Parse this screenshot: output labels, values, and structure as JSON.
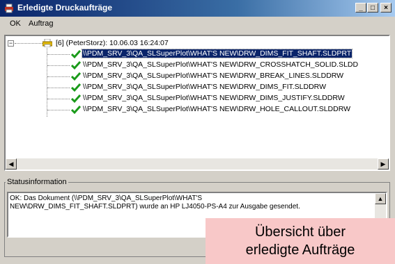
{
  "window": {
    "title": "Erledigte Druckaufträge",
    "controls": {
      "minimize": "_",
      "maximize": "□",
      "close": "×"
    }
  },
  "menu": {
    "items": [
      "OK",
      "Auftrag"
    ]
  },
  "tree": {
    "root_label": "[6] (PeterStorz): 10.06.03 16:24:07",
    "expander": "−",
    "jobs": [
      "\\\\PDM_SRV_3\\QA_SLSuperPlot\\WHAT'S NEW\\DRW_DIMS_FIT_SHAFT.SLDPRT",
      "\\\\PDM_SRV_3\\QA_SLSuperPlot\\WHAT'S NEW\\DRW_CROSSHATCH_SOLID.SLDD",
      "\\\\PDM_SRV_3\\QA_SLSuperPlot\\WHAT'S NEW\\DRW_BREAK_LINES.SLDDRW",
      "\\\\PDM_SRV_3\\QA_SLSuperPlot\\WHAT'S NEW\\DRW_DIMS_FIT.SLDDRW",
      "\\\\PDM_SRV_3\\QA_SLSuperPlot\\WHAT'S NEW\\DRW_DIMS_JUSTIFY.SLDDRW",
      "\\\\PDM_SRV_3\\QA_SLSuperPlot\\WHAT'S NEW\\DRW_HOLE_CALLOUT.SLDDRW"
    ],
    "selected_index": 0
  },
  "scroll": {
    "left_arrow": "◀",
    "right_arrow": "▶",
    "up_arrow": "▲"
  },
  "status": {
    "group_label": "Statusinformation",
    "line1": "OK: Das Dokument (\\\\PDM_SRV_3\\QA_SLSuperPlot\\WHAT'S",
    "line2": "NEW\\DRW_DIMS_FIT_SHAFT.SLDPRT) wurde an HP LJ4050-PS-A4 zur Ausgabe gesendet."
  },
  "callout": {
    "line1": "Übersicht über",
    "line2": "erledigte Aufträge"
  },
  "colors": {
    "titlebar": "#0a246a",
    "check": "#1a9a1a",
    "callout_bg": "#f8c8c8"
  }
}
